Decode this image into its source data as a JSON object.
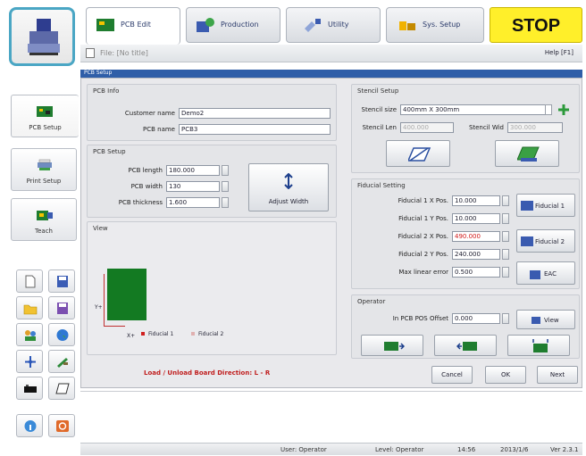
{
  "tabs": [
    {
      "label": "PCB Edit",
      "active": true
    },
    {
      "label": "Production",
      "active": false
    },
    {
      "label": "Utility",
      "active": false
    },
    {
      "label": "Sys. Setup",
      "active": false
    }
  ],
  "stop_label": "STOP",
  "file_label": "File: [No title]",
  "help_label": "Help [F1]",
  "dialog_title": "PCB Setup",
  "sidebar": {
    "items": [
      {
        "label": "PCB Setup",
        "icon": "pcb-board-icon"
      },
      {
        "label": "Print Setup",
        "icon": "print-icon"
      },
      {
        "label": "Teach",
        "icon": "camera-icon"
      }
    ]
  },
  "pcb_info": {
    "title": "PCB Info",
    "customer_label": "Customer name",
    "customer_value": "Demo2",
    "pcb_name_label": "PCB name",
    "pcb_name_value": "PCB3"
  },
  "pcb_setup": {
    "title": "PCB Setup",
    "length_label": "PCB length",
    "length_value": "180.000",
    "width_label": "PCB width",
    "width_value": "130",
    "thickness_label": "PCB thickness",
    "thickness_value": "1.600",
    "adjust_label": "Adjust Width"
  },
  "view": {
    "title": "View",
    "y_axis": "Y+",
    "x_axis": "X+",
    "legend": [
      "Fiducial 1",
      "Fiducial 2"
    ],
    "board_color": "#137a22"
  },
  "load_direction": "Load / Unload Board Direction: L - R",
  "stencil": {
    "title": "Stencil Setup",
    "size_label": "Stencil size",
    "size_value": "400mm X 300mm",
    "len_label": "Stencil Len",
    "len_value": "400.000",
    "wid_label": "Stencil Wid",
    "wid_value": "300.000"
  },
  "fiducial": {
    "title": "Fiducial Setting",
    "rows": [
      {
        "label": "Fiducial 1 X Pos.",
        "value": "10.000",
        "red": false
      },
      {
        "label": "Fiducial 1 Y Pos.",
        "value": "10.000",
        "red": false
      },
      {
        "label": "Fiducial 2 X Pos.",
        "value": "490.000",
        "red": true
      },
      {
        "label": "Fiducial 2 Y Pos.",
        "value": "240.000",
        "red": false
      },
      {
        "label": "Max linear error",
        "value": "0.500",
        "red": false
      }
    ],
    "btn1": "Fiducial 1",
    "btn2": "Fiducial 2",
    "btn3": "EAC"
  },
  "operator": {
    "title": "Operator",
    "offset_label": "In PCB POS Offset",
    "offset_value": "0.000",
    "view_btn": "View"
  },
  "actions": {
    "cancel": "Cancel",
    "ok": "OK",
    "next": "Next"
  },
  "status": {
    "user": "User: Operator",
    "level": "Level: Operator",
    "time": "14:56",
    "date": "2013/1/6",
    "version": "Ver 2.3.1"
  }
}
